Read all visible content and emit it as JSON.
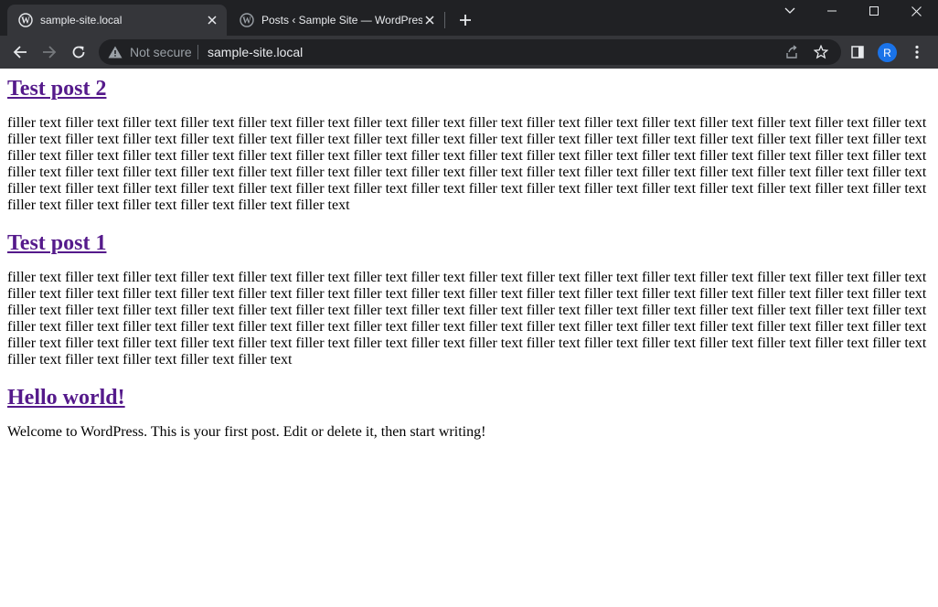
{
  "browser": {
    "tabs": [
      {
        "title": "sample-site.local",
        "active": true
      },
      {
        "title": "Posts ‹ Sample Site — WordPress",
        "active": false
      }
    ],
    "address_bar": {
      "security_label": "Not secure",
      "url": "sample-site.local"
    },
    "profile_initial": "R",
    "colors": {
      "frame": "#202124",
      "toolbar": "#35363a",
      "avatar": "#1a73e8",
      "visited_link": "#551a8b"
    }
  },
  "page": {
    "posts": [
      {
        "title": "Test post 2",
        "body": "filler text filler text filler text filler text filler text filler text filler text filler text filler text filler text filler text filler text filler text filler text filler text filler text filler text filler text filler text filler text filler text filler text filler text filler text filler text filler text filler text filler text filler text filler text filler text filler text filler text filler text filler text filler text filler text filler text filler text filler text filler text filler text filler text filler text filler text filler text filler text filler text filler text filler text filler text filler text filler text filler text filler text filler text filler text filler text filler text filler text filler text filler text filler text filler text filler text filler text filler text filler text filler text filler text filler text filler text filler text filler text filler text filler text filler text filler text filler text filler text filler text filler text filler text filler text filler text filler text"
      },
      {
        "title": "Test post 1",
        "body": "filler text filler text filler text filler text filler text filler text filler text filler text filler text filler text filler text filler text filler text filler text filler text filler text filler text filler text filler text filler text filler text filler text filler text filler text filler text filler text filler text filler text filler text filler text filler text filler text filler text filler text filler text filler text filler text filler text filler text filler text filler text filler text filler text filler text filler text filler text filler text filler text filler text filler text filler text filler text filler text filler text filler text filler text filler text filler text filler text filler text filler text filler text filler text filler text filler text filler text filler text filler text filler text filler text filler text filler text filler text filler text filler text filler text filler text filler text filler text filler text filler text filler text filler text filler text filler text"
      },
      {
        "title": "Hello world!",
        "body": "Welcome to WordPress. This is your first post. Edit or delete it, then start writing!"
      }
    ]
  }
}
